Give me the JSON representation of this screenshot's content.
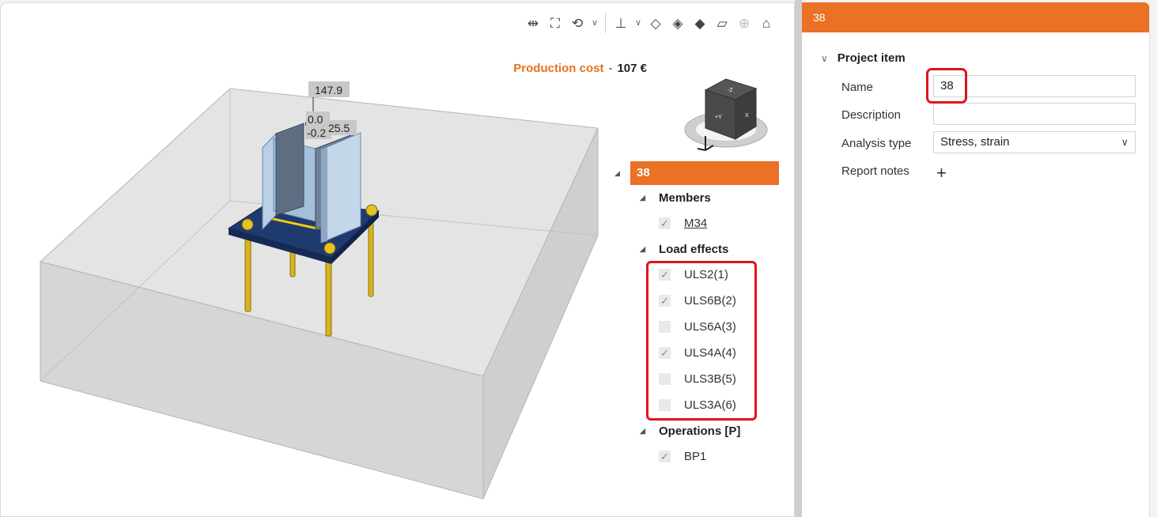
{
  "toolbar": {
    "icons": [
      "measure-icon",
      "fit-view-icon",
      "rotate-icon",
      "dropdown-icon",
      "section-cut-icon",
      "dropdown-icon",
      "wireframe-icon",
      "transparent-icon",
      "solid-icon",
      "render-mode-icon",
      "axis-icon",
      "home-icon"
    ]
  },
  "viewport": {
    "cost_label": "Production cost",
    "cost_dash": "-",
    "cost_value": "107 €",
    "dimensions": {
      "d1": "147.9",
      "d2": "0.0",
      "d3": "-0.2",
      "d4": "25.5"
    },
    "cube_labels": {
      "top": "-Z",
      "front": "+Y",
      "side": "X"
    }
  },
  "tree": {
    "root": "38",
    "groups": [
      {
        "label": "Members",
        "items": [
          {
            "label": "M34",
            "checked": true,
            "underline": true
          }
        ]
      },
      {
        "label": "Load effects",
        "items": [
          {
            "label": "ULS2(1)",
            "checked": true
          },
          {
            "label": "ULS6B(2)",
            "checked": true
          },
          {
            "label": "ULS6A(3)",
            "checked": false
          },
          {
            "label": "ULS4A(4)",
            "checked": true
          },
          {
            "label": "ULS3B(5)",
            "checked": false
          },
          {
            "label": "ULS3A(6)",
            "checked": false
          }
        ]
      },
      {
        "label": "Operations [P]",
        "items": [
          {
            "label": "BP1",
            "checked": true
          }
        ]
      }
    ]
  },
  "panel": {
    "header": "38",
    "section": "Project item",
    "name_label": "Name",
    "name_value": "38",
    "description_label": "Description",
    "description_value": "",
    "analysis_label": "Analysis type",
    "analysis_value": "Stress, strain",
    "report_label": "Report notes",
    "add_symbol": "+"
  },
  "colors": {
    "accent": "#ea7126",
    "highlight": "#e0151b",
    "plate": "#1f3a6e",
    "bolt": "#d8b41e",
    "column": "#aac4e0"
  }
}
